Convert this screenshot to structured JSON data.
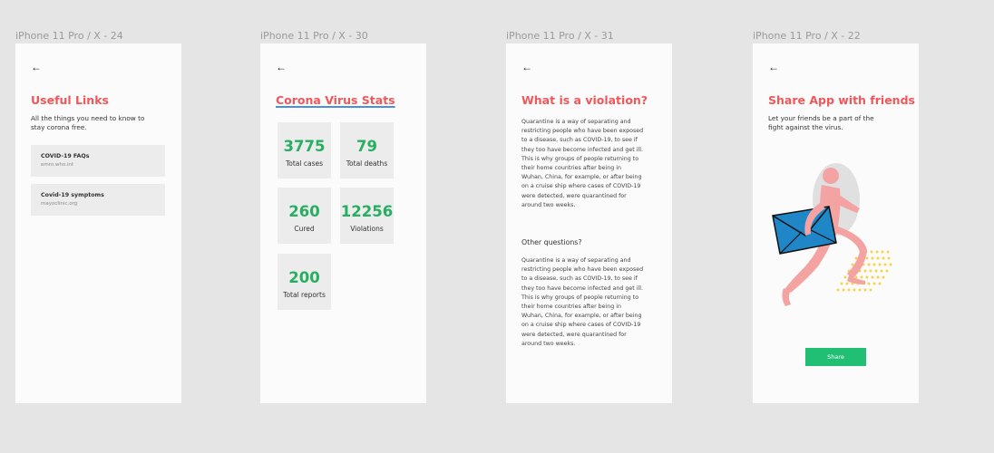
{
  "frames": {
    "f1": {
      "label": "iPhone 11 Pro / X - 24",
      "back": "←",
      "title": "Useful Links",
      "subtitle": "All the things you need to know to stay corona free.",
      "links": [
        {
          "title": "COVID-19 FAQs",
          "url": "emro.who.int"
        },
        {
          "title": "Covid-19 symptoms",
          "url": "mayoclinic.org"
        }
      ]
    },
    "f2": {
      "label": "iPhone 11 Pro / X - 30",
      "back": "←",
      "title": "Corona Virus Stats",
      "stats": [
        {
          "value": "3775",
          "label": "Total cases"
        },
        {
          "value": "79",
          "label": "Total deaths"
        },
        {
          "value": "260",
          "label": "Cured"
        },
        {
          "value": "12256",
          "label": "Violations"
        },
        {
          "value": "200",
          "label": "Total reports"
        }
      ]
    },
    "f3": {
      "label": "iPhone 11 Pro / X - 31",
      "back": "←",
      "title": "What is a violation?",
      "para1": "Quarantine is a way of separating and restricting people who have been exposed to a disease, such as COVID-19, to see if they too have become infected and get ill. This is why groups of people returning to their home countries after being in Wuhan, China, for example, or after being on a cruise ship where cases of COVID-19 were detected, were quarantined for around two weeks.",
      "subhead": "Other questions?",
      "para2": "Quarantine is a way of separating and restricting people who have been exposed to a disease, such as COVID-19, to see if they too have become infected and get ill. This is why groups of people returning to their home countries after being in Wuhan, China, for example, or after being on a cruise ship where cases of COVID-19 were detected, were quarantined for around two weeks."
    },
    "f4": {
      "label": "iPhone 11 Pro / X - 22",
      "back": "←",
      "title": "Share App with friends",
      "subtitle": "Let your friends be a part of the fight against the virus.",
      "share_label": "Share"
    }
  },
  "colors": {
    "background": "#e5e5e5",
    "frame": "#fafbfa",
    "title": "#f0575a",
    "stat": "#27ae60",
    "button": "#21bf73",
    "underline": "#4a90d9",
    "illustration_body": "#f4a3a3",
    "envelope": "#1f86c8",
    "dots": "#f7d54a"
  },
  "icons": [
    "back-arrow-icon",
    "runner-envelope-illustration"
  ]
}
